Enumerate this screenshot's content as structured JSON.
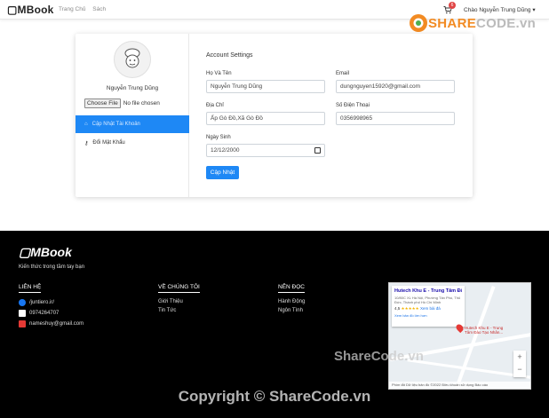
{
  "nav": {
    "brand": "MBook",
    "links": [
      "Trang Chủ",
      "Sách"
    ],
    "cart_count": "6",
    "greeting": "Chào Nguyễn Trung Dũng ▾"
  },
  "watermark": {
    "logo_prefix": "SHARE",
    "logo_suffix": "CODE.vn",
    "mid": "ShareCode.vn",
    "copyright": "Copyright © ShareCode.vn"
  },
  "profile": {
    "name": "Nguyễn Trung Dũng",
    "file_button": "Choose File",
    "file_status": "No file chosen",
    "menu": [
      {
        "label": "Cập Nhật Tài Khoản",
        "icon": "home-icon"
      },
      {
        "label": "Đổi Mật Khẩu",
        "icon": "key-icon"
      }
    ]
  },
  "form": {
    "title": "Account Settings",
    "fullname_label": "Họ Và Tên",
    "fullname_value": "Nguyễn Trung Dũng",
    "email_label": "Email",
    "email_value": "dungnguyen15920@gmail.com",
    "address_label": "Địa Chỉ",
    "address_value": "Ấp Gò Đồ,Xã Gò Đồ",
    "phone_label": "Số Điện Thoại",
    "phone_value": "0356998965",
    "birthday_label": "Ngày Sinh",
    "birthday_value": "12/12/2000",
    "submit_label": "Cập Nhật"
  },
  "footer": {
    "brand": "MBook",
    "tagline": "Kiến thức trong tầm tay bạn",
    "contact_heading": "LIÊN HỆ",
    "contacts": [
      "/juntiero.ir/",
      "0974264707",
      "nameshuy@gmail.com"
    ],
    "about_heading": "VỀ CHÚNG TÔI",
    "about_links": [
      "Giới Thiệu",
      "Tin Tức"
    ],
    "genre_heading": "NÊN ĐỌC",
    "genre_links": [
      "Hành Động",
      "Ngôn Tình"
    ],
    "map": {
      "place": "Hutech Khu E - Trung Tâm Đà...",
      "address": "10/80C XL Hà Nội, Phường Tân Phú, Thủ Đức, Thành phố Hồ Chí Minh",
      "rating": "4,5",
      "reviews_link": "Xem bài đá",
      "larger_map": "Xem bản đồ lớn hơn",
      "pin_label": "Hutech Khu E - Trung Tâm Đào Tạo Nhân...",
      "footer_text": "Phím tắt  Dữ liệu bản đồ ©2022  Điều khoản sử dụng  Báo cáo"
    }
  },
  "colors": {
    "accent": "#1e88f5",
    "footer_bg": "#000000"
  }
}
